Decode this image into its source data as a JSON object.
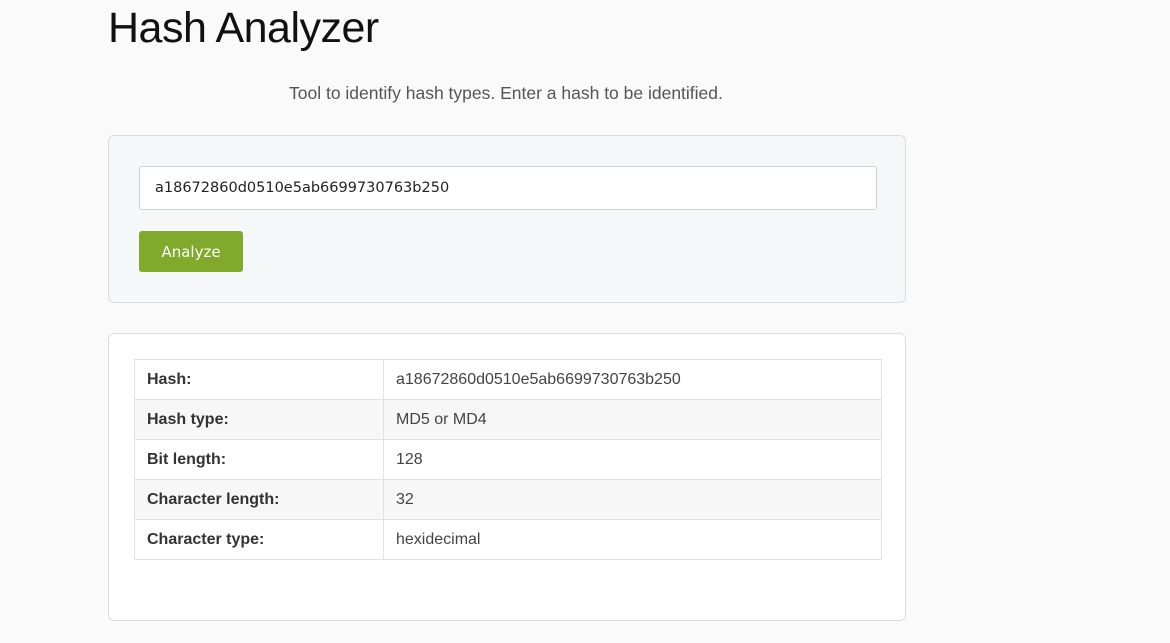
{
  "header": {
    "title": "Hash Analyzer",
    "subtitle": "Tool to identify hash types. Enter a hash to be identified."
  },
  "form": {
    "input_value": "a18672860d0510e5ab6699730763b250",
    "button_label": "Analyze"
  },
  "results": {
    "rows": [
      {
        "label": "Hash:",
        "value": "a18672860d0510e5ab6699730763b250"
      },
      {
        "label": "Hash type:",
        "value": "MD5 or MD4"
      },
      {
        "label": "Bit length:",
        "value": "128"
      },
      {
        "label": "Character length:",
        "value": "32"
      },
      {
        "label": "Character type:",
        "value": "hexidecimal"
      }
    ]
  },
  "colors": {
    "button": "#7faa2b",
    "page_background": "#fafafa"
  }
}
